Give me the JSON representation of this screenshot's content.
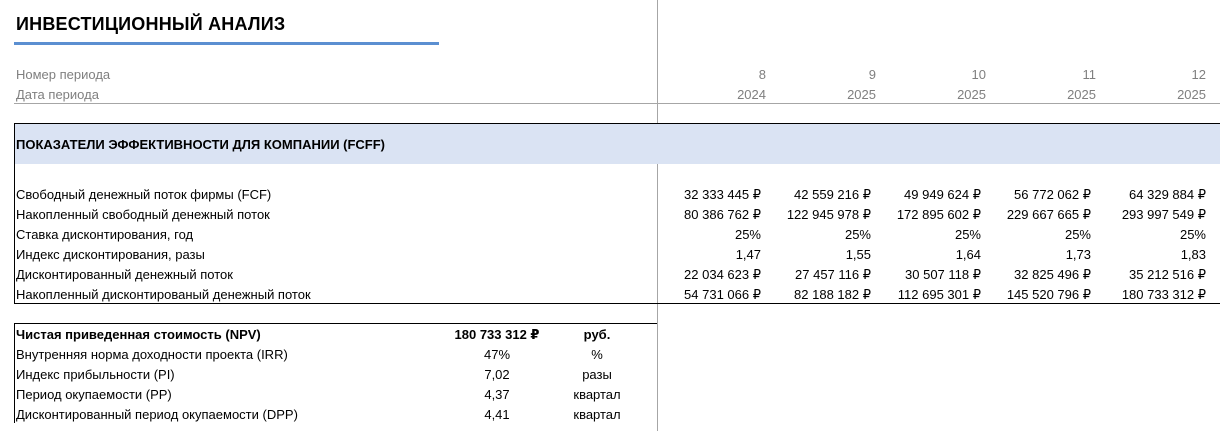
{
  "title": "ИНВЕСТИЦИОННЫЙ АНАЛИЗ",
  "header": {
    "period_number_label": "Номер периода",
    "period_date_label": "Дата периода",
    "periods": [
      "8",
      "9",
      "10",
      "11",
      "12"
    ],
    "dates": [
      "2024",
      "2025",
      "2025",
      "2025",
      "2025"
    ]
  },
  "section": {
    "title": "ПОКАЗАТЕЛИ ЭФФЕКТИВНОСТИ ДЛЯ КОМПАНИИ (FCFF)",
    "rows": [
      {
        "label": "Свободный денежный поток фирмы (FCF)",
        "values": [
          "32 333 445 ₽",
          "42 559 216 ₽",
          "49 949 624 ₽",
          "56 772 062 ₽",
          "64 329 884 ₽"
        ]
      },
      {
        "label": "Накопленный свободный денежный поток",
        "values": [
          "80 386 762 ₽",
          "122 945 978 ₽",
          "172 895 602 ₽",
          "229 667 665 ₽",
          "293 997 549 ₽"
        ]
      },
      {
        "label": "Ставка дисконтирования, год",
        "values": [
          "25%",
          "25%",
          "25%",
          "25%",
          "25%"
        ]
      },
      {
        "label": "Индекс дисконтирования, разы",
        "values": [
          "1,47",
          "1,55",
          "1,64",
          "1,73",
          "1,83"
        ]
      },
      {
        "label": "Дисконтированный денежный поток",
        "values": [
          "22 034 623 ₽",
          "27 457 116 ₽",
          "30 507 118 ₽",
          "32 825 496 ₽",
          "35 212 516 ₽"
        ]
      },
      {
        "label": "Накопленный дисконтированый денежный поток",
        "values": [
          "54 731 066 ₽",
          "82 188 182 ₽",
          "112 695 301 ₽",
          "145 520 796 ₽",
          "180 733 312 ₽"
        ]
      }
    ]
  },
  "summary": [
    {
      "label": "Чистая приведенная стоимость (NPV)",
      "value": "180 733 312 ₽",
      "unit": "руб."
    },
    {
      "label": "Внутренняя норма доходности проекта (IRR)",
      "value": "47%",
      "unit": "%"
    },
    {
      "label": "Индекс прибыльности (PI)",
      "value": "7,02",
      "unit": "разы"
    },
    {
      "label": "Период окупаемости (PP)",
      "value": "4,37",
      "unit": "квартал"
    },
    {
      "label": "Дисконтированный период окупаемости (DPP)",
      "value": "4,41",
      "unit": "квартал"
    }
  ]
}
